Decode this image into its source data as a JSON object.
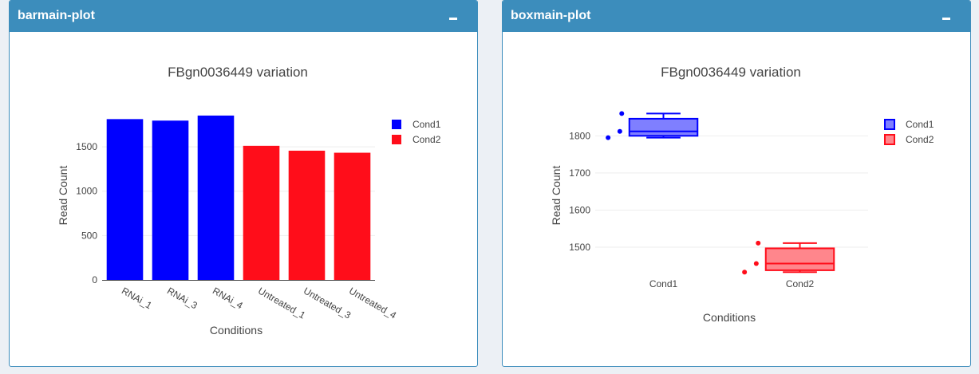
{
  "panels": [
    {
      "title": "barmain-plot",
      "chart_data": {
        "type": "bar",
        "title": "FBgn0036449 variation",
        "xlabel": "Conditions",
        "ylabel": "Read Count",
        "categories": [
          "RNAi_1",
          "RNAi_3",
          "RNAi_4",
          "Untreated_1",
          "Untreated_3",
          "Untreated_4"
        ],
        "values": [
          1812,
          1795,
          1852,
          1511,
          1456,
          1433
        ],
        "bar_groups": [
          "Cond1",
          "Cond1",
          "Cond1",
          "Cond2",
          "Cond2",
          "Cond2"
        ],
        "ylim": [
          0,
          1950
        ],
        "yticks": [
          0,
          500,
          1000,
          1500
        ],
        "grid": true,
        "legend": {
          "placement": "top-right",
          "entries": [
            "Cond1",
            "Cond2"
          ]
        },
        "colors": {
          "Cond1": "#0000ff",
          "Cond2": "#ff0d1a"
        }
      }
    },
    {
      "title": "boxmain-plot",
      "chart_data": {
        "type": "box",
        "title": "FBgn0036449 variation",
        "xlabel": "Conditions",
        "ylabel": "Read Count",
        "categories": [
          "Cond1",
          "Cond2"
        ],
        "series": [
          {
            "name": "Cond1",
            "points": [
              1795,
              1812,
              1860
            ],
            "min": 1795,
            "q1": 1800,
            "median": 1812,
            "q3": 1846,
            "max": 1860,
            "color": "#0000ff"
          },
          {
            "name": "Cond2",
            "points": [
              1433,
              1456,
              1511
            ],
            "min": 1433,
            "q1": 1438,
            "median": 1456,
            "q3": 1497,
            "max": 1511,
            "color": "#ff0d1a"
          }
        ],
        "ylim": [
          1412,
          1878
        ],
        "yticks": [
          1500,
          1600,
          1700,
          1800
        ],
        "grid": true,
        "legend": {
          "placement": "top-right",
          "entries": [
            "Cond1",
            "Cond2"
          ]
        }
      }
    }
  ]
}
